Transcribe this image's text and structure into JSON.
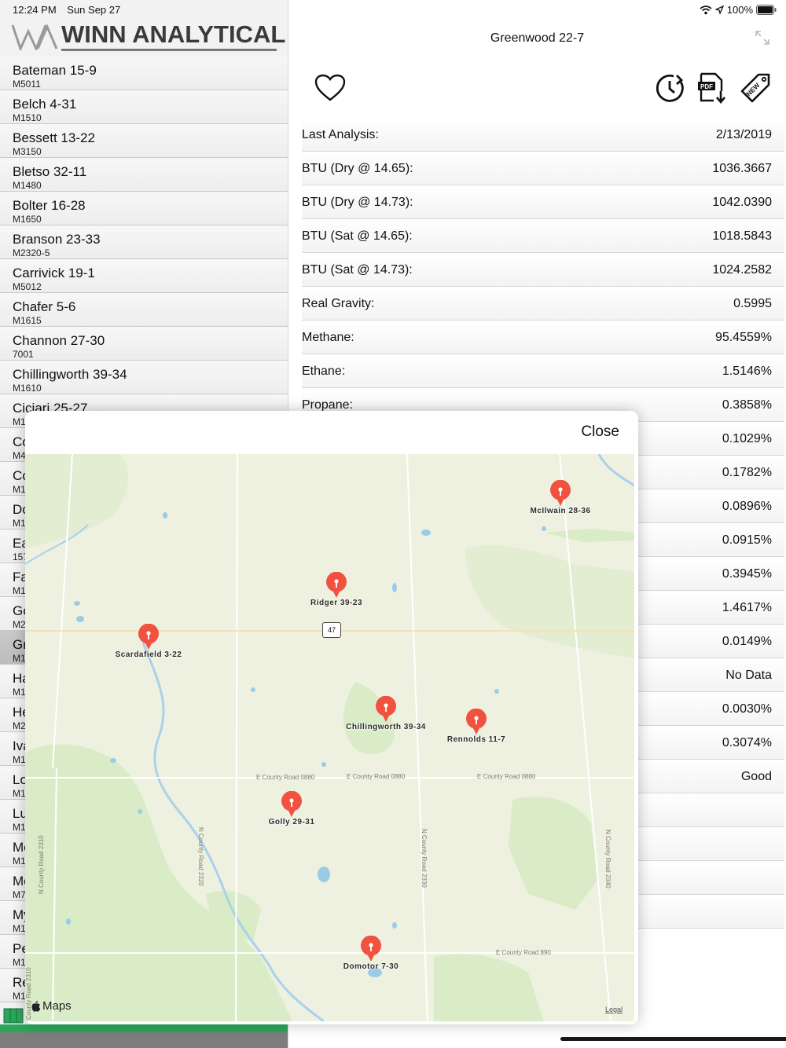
{
  "status": {
    "time": "12:24 PM",
    "date": "Sun Sep 27",
    "battery": "100%"
  },
  "brand": {
    "logo_text": "WINN ANALYTICAL"
  },
  "wells": [
    {
      "name": "Bateman 15-9",
      "code": "M5011"
    },
    {
      "name": "Belch 4-31",
      "code": "M1510"
    },
    {
      "name": "Bessett 13-22",
      "code": "M3150"
    },
    {
      "name": "Bletso 32-11",
      "code": "M1480"
    },
    {
      "name": "Bolter 16-28",
      "code": "M1650"
    },
    {
      "name": "Branson 23-33",
      "code": "M2320-5"
    },
    {
      "name": "Carrivick 19-1",
      "code": "M5012"
    },
    {
      "name": "Chafer 5-6",
      "code": "M1615"
    },
    {
      "name": "Channon 27-30",
      "code": "7001"
    },
    {
      "name": "Chillingworth 39-34",
      "code": "M1610"
    },
    {
      "name": "Ciciari 25-27",
      "code": "M1"
    },
    {
      "name": "Cc",
      "code": "M4"
    },
    {
      "name": "Cc",
      "code": "M1"
    },
    {
      "name": "Dc",
      "code": "M1"
    },
    {
      "name": "Ea",
      "code": "157"
    },
    {
      "name": "Fa",
      "code": "M1"
    },
    {
      "name": "Gc",
      "code": "M2"
    },
    {
      "name": "Gr",
      "code": "M1"
    },
    {
      "name": "Ha",
      "code": "M1"
    },
    {
      "name": "He",
      "code": "M2"
    },
    {
      "name": "Iva",
      "code": "M1"
    },
    {
      "name": "Lo",
      "code": "M1"
    },
    {
      "name": "Lu",
      "code": "M1"
    },
    {
      "name": "Mc",
      "code": "M1"
    },
    {
      "name": "Mc",
      "code": "M7"
    },
    {
      "name": "My",
      "code": "M1"
    },
    {
      "name": "Pe",
      "code": "M1"
    },
    {
      "name": "Re",
      "code": "M1"
    }
  ],
  "detail": {
    "title": "Greenwood 22-7",
    "rows": [
      {
        "label": "Last Analysis:",
        "value": "2/13/2019"
      },
      {
        "label": "BTU (Dry @ 14.65):",
        "value": "1036.3667"
      },
      {
        "label": "BTU (Dry @ 14.73):",
        "value": "1042.0390"
      },
      {
        "label": "BTU (Sat @ 14.65):",
        "value": "1018.5843"
      },
      {
        "label": "BTU (Sat @ 14.73):",
        "value": "1024.2582"
      },
      {
        "label": "Real Gravity:",
        "value": "0.5995"
      },
      {
        "label": "Methane:",
        "value": "95.4559%"
      },
      {
        "label": "Ethane:",
        "value": "1.5146%"
      },
      {
        "label": "Propane:",
        "value": "0.3858%"
      },
      {
        "label": "",
        "value": "0.1029%"
      },
      {
        "label": "",
        "value": "0.1782%"
      },
      {
        "label": "",
        "value": "0.0896%"
      },
      {
        "label": "",
        "value": "0.0915%"
      },
      {
        "label": "",
        "value": "0.3945%"
      },
      {
        "label": "",
        "value": "1.4617%"
      },
      {
        "label": "",
        "value": "0.0149%"
      },
      {
        "label": "",
        "value": "No Data"
      },
      {
        "label": "",
        "value": "0.0030%"
      },
      {
        "label": "",
        "value": "0.3074%"
      },
      {
        "label": "",
        "value": "Good"
      },
      {
        "label": "",
        "value": ""
      },
      {
        "label": "",
        "value": ""
      },
      {
        "label": "",
        "value": ""
      },
      {
        "label": "",
        "value": ""
      }
    ]
  },
  "map_modal": {
    "close_label": "Close",
    "attribution": "Maps",
    "legal_label": "Legal",
    "route_shield": "47",
    "pins": [
      {
        "label": "McIlwain 28-36"
      },
      {
        "label": "Ridger 39-23"
      },
      {
        "label": "Scardafield 3-22"
      },
      {
        "label": "Chillingworth 39-34"
      },
      {
        "label": "Rennolds 11-7"
      },
      {
        "label": "Golly 29-31"
      },
      {
        "label": "Domotor 7-30"
      }
    ],
    "roads": [
      {
        "label": "E County Road 0880"
      },
      {
        "label": "E County Road 0880"
      },
      {
        "label": "E County Road 0880"
      },
      {
        "label": "N County Road 2320"
      },
      {
        "label": "N County Road 2330"
      },
      {
        "label": "N County Road 2340"
      },
      {
        "label": "N County Road 2310"
      },
      {
        "label": "E County Road 890"
      },
      {
        "label": "County Road 2310"
      }
    ]
  },
  "colors": {
    "pin": "#f0523f",
    "map_background": "#eef0e0",
    "map_green": "#d9ebc6",
    "water": "#9ccbe8",
    "accent_green": "#2aa65a",
    "selected_row": "#c2c2c2"
  }
}
